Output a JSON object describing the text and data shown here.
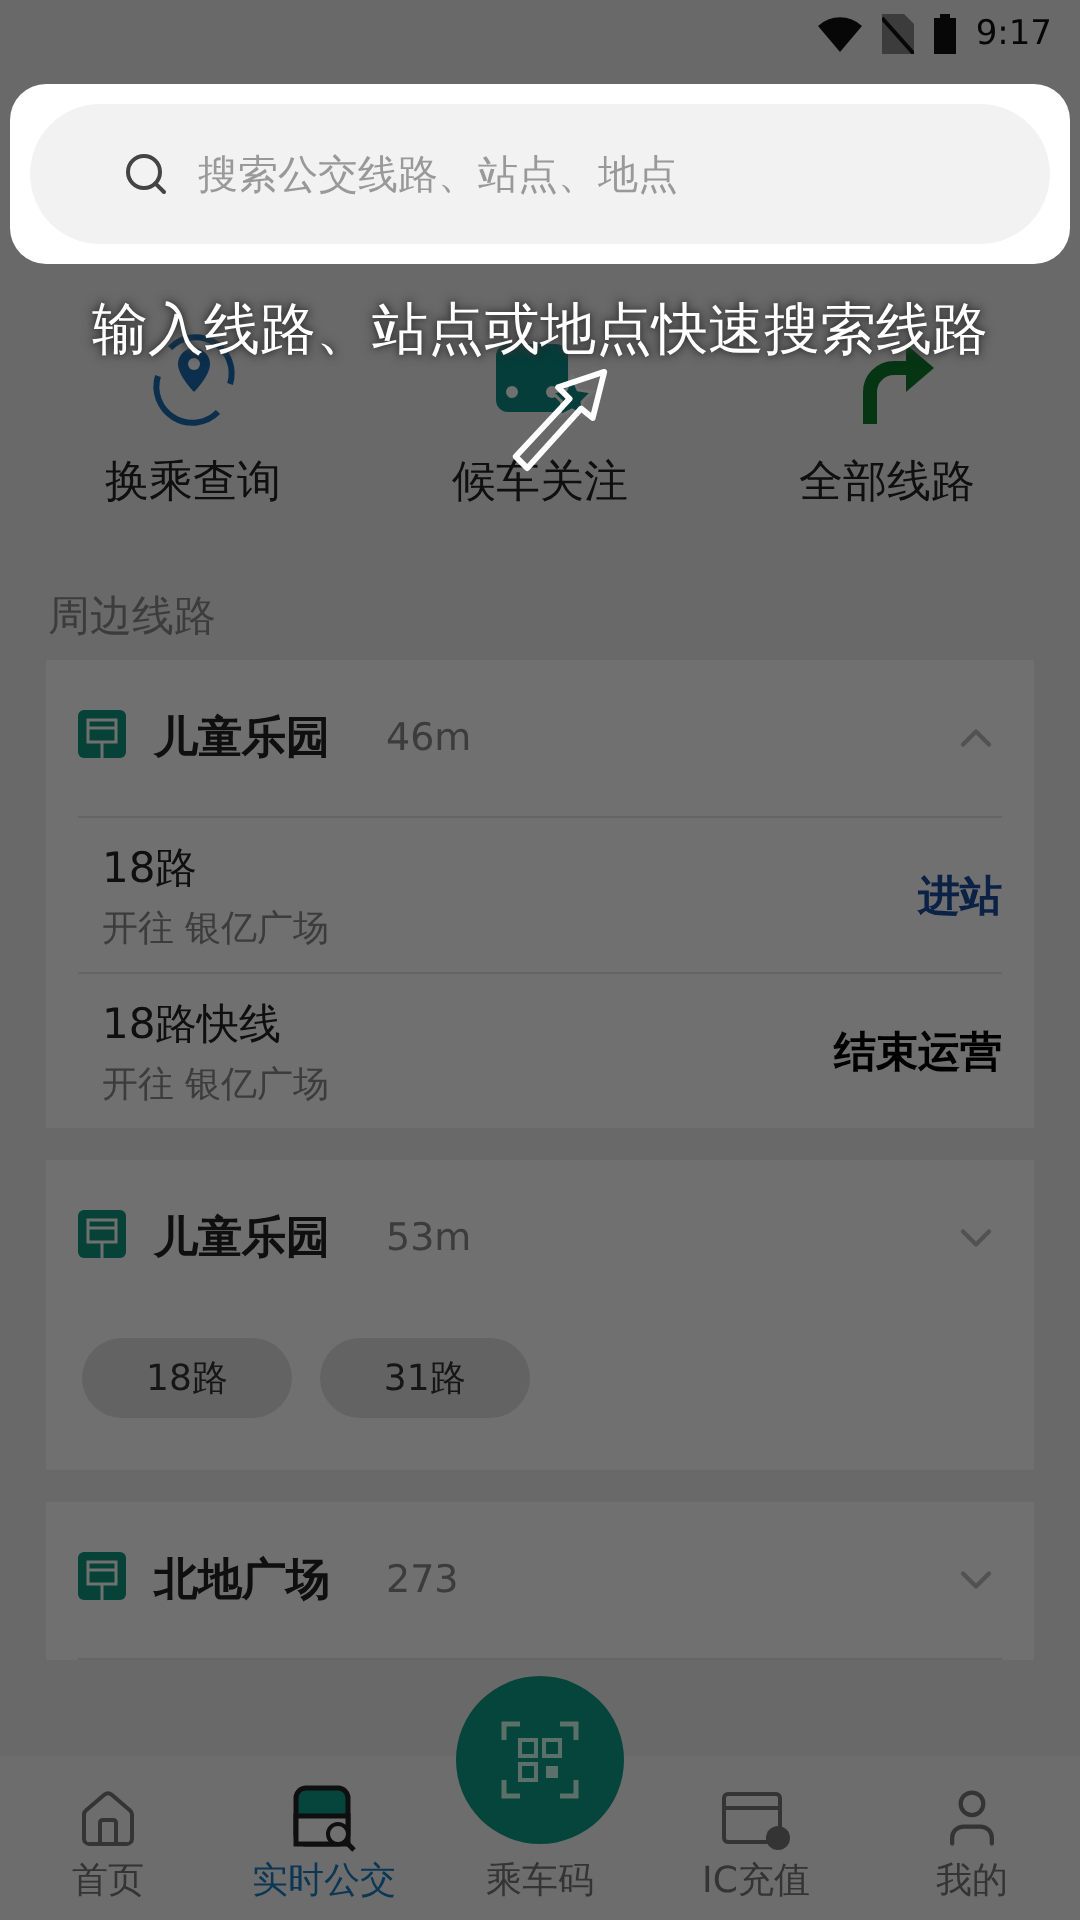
{
  "status_bar": {
    "time": "9:17"
  },
  "search": {
    "placeholder": "搜索公交线路、站点、地点"
  },
  "guide": {
    "text": "输入线路、站点或地点快速搜索线路"
  },
  "shortcuts": [
    {
      "label": "换乘查询",
      "kind": "transfer"
    },
    {
      "label": "候车关注",
      "kind": "favorite"
    },
    {
      "label": "全部线路",
      "kind": "routes"
    }
  ],
  "nearby": {
    "title": "周边线路",
    "stations": [
      {
        "name": "儿童乐园",
        "distance": "46m",
        "expanded": true,
        "lines": [
          {
            "name": "18路",
            "destination": "开往 银亿广场",
            "status": "进站",
            "kind": "arriving"
          },
          {
            "name": "18路快线",
            "destination": "开往 银亿广场",
            "status": "结束运营",
            "kind": "ended"
          }
        ]
      },
      {
        "name": "儿童乐园",
        "distance": "53m",
        "expanded": false,
        "route_tags": [
          "18路",
          "31路"
        ]
      },
      {
        "name": "北地广场",
        "distance": "273",
        "expanded": false
      }
    ]
  },
  "bottom_nav": [
    {
      "label": "首页",
      "kind": "home",
      "selected": false
    },
    {
      "label": "实时公交",
      "kind": "bus",
      "selected": true
    },
    {
      "label": "乘车码",
      "kind": "qr",
      "selected": false
    },
    {
      "label": "IC充值",
      "kind": "card",
      "selected": false
    },
    {
      "label": "我的",
      "kind": "user",
      "selected": false
    }
  ]
}
